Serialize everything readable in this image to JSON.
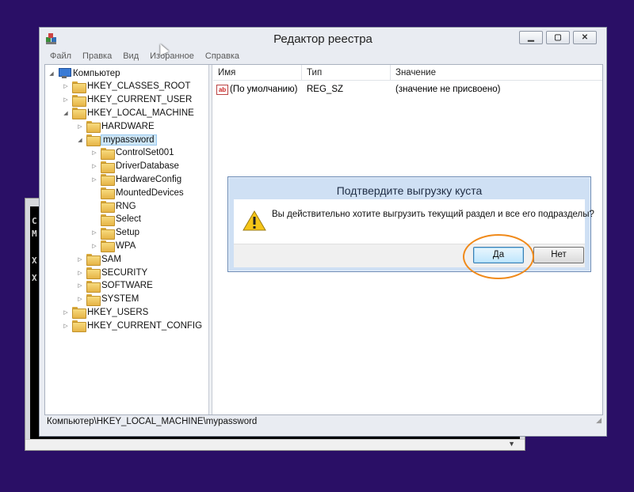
{
  "window": {
    "title": "Редактор реестра"
  },
  "menubar": [
    "Файл",
    "Правка",
    "Вид",
    "Избранное",
    "Справка"
  ],
  "tree": {
    "root": "Компьютер",
    "items": [
      {
        "label": "HKEY_CLASSES_ROOT",
        "level": 1,
        "toggle": "▷"
      },
      {
        "label": "HKEY_CURRENT_USER",
        "level": 1,
        "toggle": "▷"
      },
      {
        "label": "HKEY_LOCAL_MACHINE",
        "level": 1,
        "toggle": "◢"
      },
      {
        "label": "HARDWARE",
        "level": 2,
        "toggle": "▷"
      },
      {
        "label": "mypassword",
        "level": 2,
        "toggle": "◢",
        "selected": true
      },
      {
        "label": "ControlSet001",
        "level": 3,
        "toggle": "▷"
      },
      {
        "label": "DriverDatabase",
        "level": 3,
        "toggle": "▷"
      },
      {
        "label": "HardwareConfig",
        "level": 3,
        "toggle": "▷"
      },
      {
        "label": "MountedDevices",
        "level": 3,
        "toggle": ""
      },
      {
        "label": "RNG",
        "level": 3,
        "toggle": ""
      },
      {
        "label": "Select",
        "level": 3,
        "toggle": ""
      },
      {
        "label": "Setup",
        "level": 3,
        "toggle": "▷"
      },
      {
        "label": "WPA",
        "level": 3,
        "toggle": "▷"
      },
      {
        "label": "SAM",
        "level": 2,
        "toggle": "▷"
      },
      {
        "label": "SECURITY",
        "level": 2,
        "toggle": "▷"
      },
      {
        "label": "SOFTWARE",
        "level": 2,
        "toggle": "▷"
      },
      {
        "label": "SYSTEM",
        "level": 2,
        "toggle": "▷"
      },
      {
        "label": "HKEY_USERS",
        "level": 1,
        "toggle": "▷"
      },
      {
        "label": "HKEY_CURRENT_CONFIG",
        "level": 1,
        "toggle": "▷"
      }
    ]
  },
  "list": {
    "columns": [
      "Имя",
      "Тип",
      "Значение"
    ],
    "rows": [
      {
        "icon": "ab",
        "name": "(По умолчанию)",
        "type": "REG_SZ",
        "value": "(значение не присвоено)"
      }
    ]
  },
  "statusbar": {
    "path": "Компьютер\\HKEY_LOCAL_MACHINE\\mypassword"
  },
  "dialog": {
    "title": "Подтвердите выгрузку куста",
    "message": "Вы действительно хотите выгрузить текущий раздел и все его подразделы?",
    "yes_label": "Да",
    "no_label": "Нет"
  },
  "console": {
    "lines": [
      "C",
      "M",
      "X",
      "X"
    ]
  },
  "colors": {
    "desktop": "#2a0f66",
    "highlight": "#f08a1a"
  }
}
